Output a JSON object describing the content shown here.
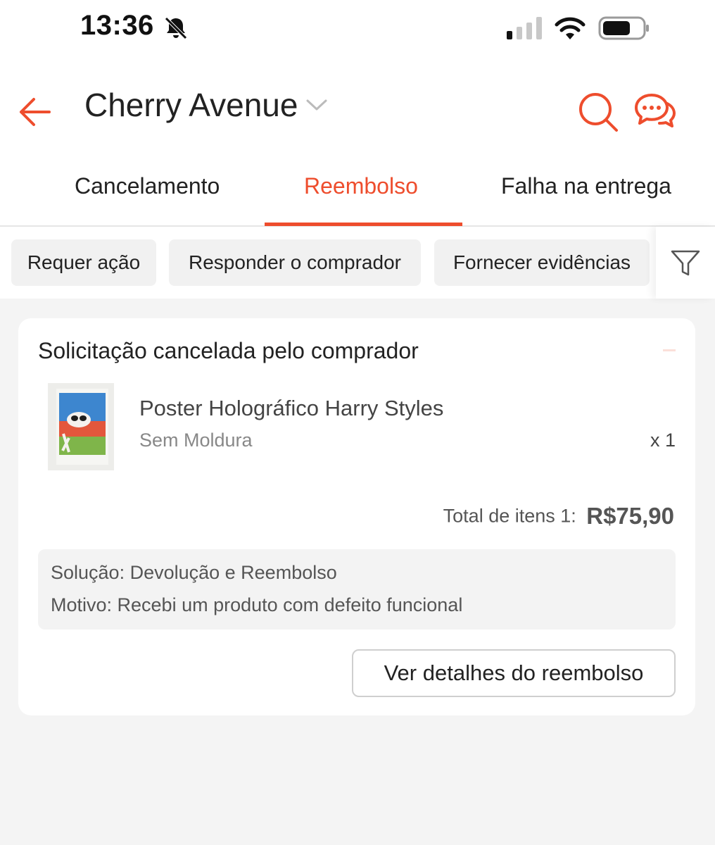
{
  "status_bar": {
    "time": "13:36",
    "icons": [
      "bell-slash-icon",
      "signal-icon",
      "wifi-icon",
      "battery-icon"
    ]
  },
  "header": {
    "title": "Cherry Avenue",
    "accent_color": "#ee4d2d",
    "icons": [
      "back-arrow-icon",
      "chevron-down-icon",
      "search-icon",
      "chat-icon"
    ]
  },
  "tabs": [
    {
      "label": "Cancelamento",
      "active": false
    },
    {
      "label": "Reembolso",
      "active": true
    },
    {
      "label": "Falha na entrega",
      "active": false
    }
  ],
  "filters": {
    "chips": [
      "Requer ação",
      "Responder o comprador",
      "Fornecer evidências"
    ],
    "icon": "filter-icon"
  },
  "request_card": {
    "status_title": "Solicitação cancelada pelo comprador",
    "product": {
      "name": "Poster Holográfico Harry Styles",
      "variation": "Sem Moldura",
      "quantity": "x 1"
    },
    "total_label": "Total de itens 1:",
    "total_value": "R$75,90",
    "solution": "Solução: Devolução e Reembolso",
    "reason": "Motivo: Recebi um produto com defeito funcional",
    "details_button": "Ver detalhes do reembolso"
  }
}
